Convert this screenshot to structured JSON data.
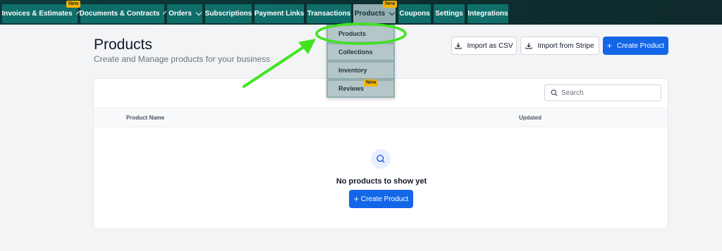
{
  "nav": {
    "tabs": [
      {
        "label": "Invoices & Estimates",
        "dropdown": true,
        "badge": "New"
      },
      {
        "label": "Documents & Contracts",
        "dropdown": true
      },
      {
        "label": "Orders",
        "dropdown": true
      },
      {
        "label": "Subscriptions"
      },
      {
        "label": "Payment Links"
      },
      {
        "label": "Transactions"
      },
      {
        "label": "Products",
        "dropdown": true,
        "badge": "New",
        "active": true
      },
      {
        "label": "Coupons"
      },
      {
        "label": "Settings"
      },
      {
        "label": "Integrations"
      }
    ],
    "products_menu": [
      {
        "label": "Products"
      },
      {
        "label": "Collections"
      },
      {
        "label": "Inventory"
      },
      {
        "label": "Reviews",
        "badge": "New"
      }
    ]
  },
  "page": {
    "title": "Products",
    "subtitle": "Create and Manage products for your business"
  },
  "actions": {
    "import_csv": "Import as CSV",
    "import_stripe": "Import from Stripe",
    "create_product": "Create Product"
  },
  "search": {
    "placeholder": "Search"
  },
  "table": {
    "columns": [
      "Product Name",
      "Updated"
    ]
  },
  "empty_state": {
    "message": "No products to show yet",
    "button": "Create Product"
  },
  "colors": {
    "nav_bg": "#0d2e2f",
    "tab": "#0f6e6a",
    "tab_active": "#93aeb0",
    "primary": "#1366e8",
    "badge": "#f5b400",
    "annotation": "#3fe41e"
  }
}
